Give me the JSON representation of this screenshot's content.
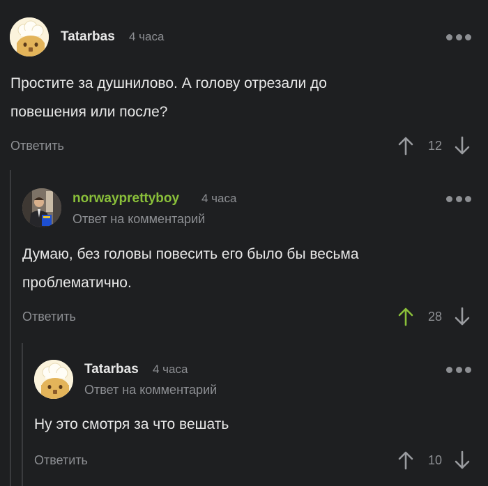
{
  "colors": {
    "background": "#1e1f21",
    "text": "#e8e8e8",
    "muted": "#8d8f93",
    "username_highlight": "#8ac03a",
    "upvote_active": "#8ac03a",
    "thread_line": "#3a3b3e"
  },
  "comments": [
    {
      "username": "Tatarbas",
      "time": "4 часа",
      "subline": "",
      "avatar": "cat-chef-avatar",
      "text_lines": [
        "Простите за душнилово. А голову отрезали до",
        "повешения или после?"
      ],
      "reply_label": "Ответить",
      "rating": "12",
      "upvoted": false
    },
    {
      "username": "norwayprettyboy",
      "time": "4 часа",
      "subline": "Ответ на комментарий",
      "avatar": "man-in-suit-avatar",
      "text_lines": [
        "Думаю, без головы повесить его было бы весьма",
        "проблематично."
      ],
      "reply_label": "Ответить",
      "rating": "28",
      "upvoted": true
    },
    {
      "username": "Tatarbas",
      "time": "4 часа",
      "subline": "Ответ на комментарий",
      "avatar": "cat-chef-avatar",
      "text_lines": [
        "Ну это смотря за что вешать"
      ],
      "reply_label": "Ответить",
      "rating": "10",
      "upvoted": false
    }
  ]
}
